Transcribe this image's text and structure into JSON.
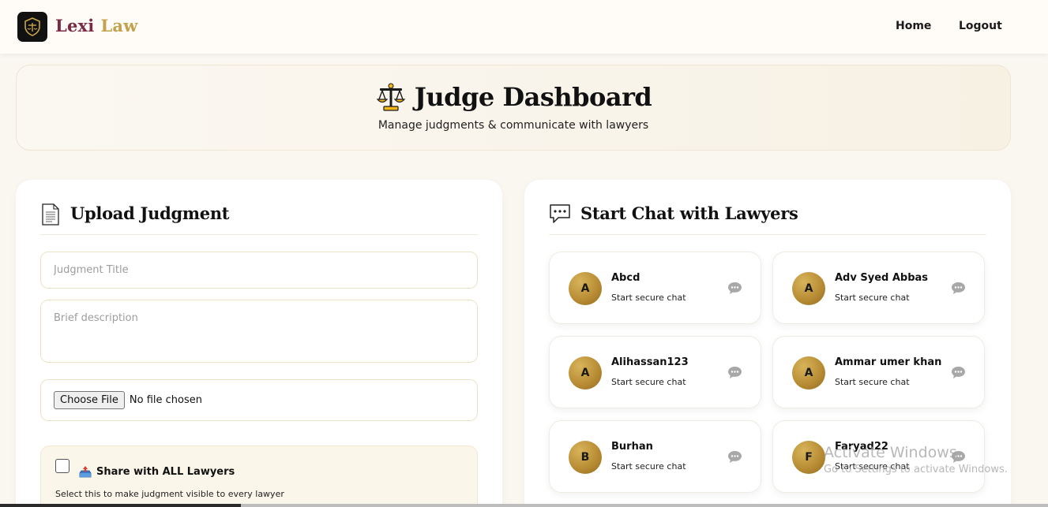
{
  "header": {
    "brand_part1": "Lexi",
    "brand_part2": "Law",
    "nav": {
      "home": "Home",
      "logout": "Logout"
    }
  },
  "hero": {
    "title": "Judge Dashboard",
    "subtitle": "Manage judgments & communicate with lawyers"
  },
  "upload": {
    "heading": "Upload  Judgment",
    "title_placeholder": "Judgment Title",
    "description_placeholder": "Brief description",
    "file_button": "Choose File",
    "file_status": "No file chosen",
    "share_label": "Share with ALL Lawyers",
    "share_hint": "Select this to make judgment visible to every lawyer"
  },
  "chat": {
    "heading": "Start Chat with  Lawyers",
    "lawyers": [
      {
        "initial": "A",
        "name": "Abcd",
        "subtitle": "Start secure chat"
      },
      {
        "initial": "A",
        "name": "Adv Syed Abbas",
        "subtitle": "Start secure chat"
      },
      {
        "initial": "A",
        "name": "Alihassan123",
        "subtitle": "Start secure chat"
      },
      {
        "initial": "A",
        "name": "Ammar umer khan",
        "subtitle": "Start secure chat"
      },
      {
        "initial": "B",
        "name": "Burhan",
        "subtitle": "Start secure chat"
      },
      {
        "initial": "F",
        "name": "Faryad22",
        "subtitle": "Start secure chat"
      }
    ]
  },
  "watermark": {
    "line1": "Activate Windows",
    "line2": "Go to Settings to activate Windows."
  },
  "colors": {
    "brand_maroon": "#7a2a44",
    "brand_gold": "#c2a24c",
    "avatar_gold": "#b68a32",
    "page_bg": "#faf7f1"
  }
}
